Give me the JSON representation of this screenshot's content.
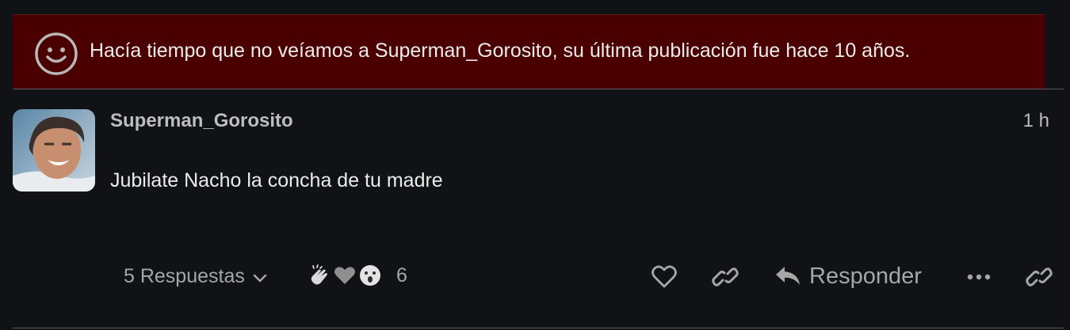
{
  "notice": {
    "icon": "smiley-icon",
    "text": "Hacía tiempo que no veíamos a Superman_Gorosito, su última publicación fue hace 10 años."
  },
  "post": {
    "username": "Superman_Gorosito",
    "timestamp": "1 h",
    "body": "Jubilate Nacho la concha de tu madre",
    "avatar": "avatar"
  },
  "actions": {
    "replies_label": "5 Respuestas",
    "reactions": [
      "clapping-hands-icon",
      "grey-heart-icon",
      "astonished-face-icon"
    ],
    "reaction_count": "6",
    "reply_label": "Responder"
  },
  "colors": {
    "background": "#111215",
    "notice_background": "#4a0000",
    "muted_text": "#a6a6a6"
  }
}
